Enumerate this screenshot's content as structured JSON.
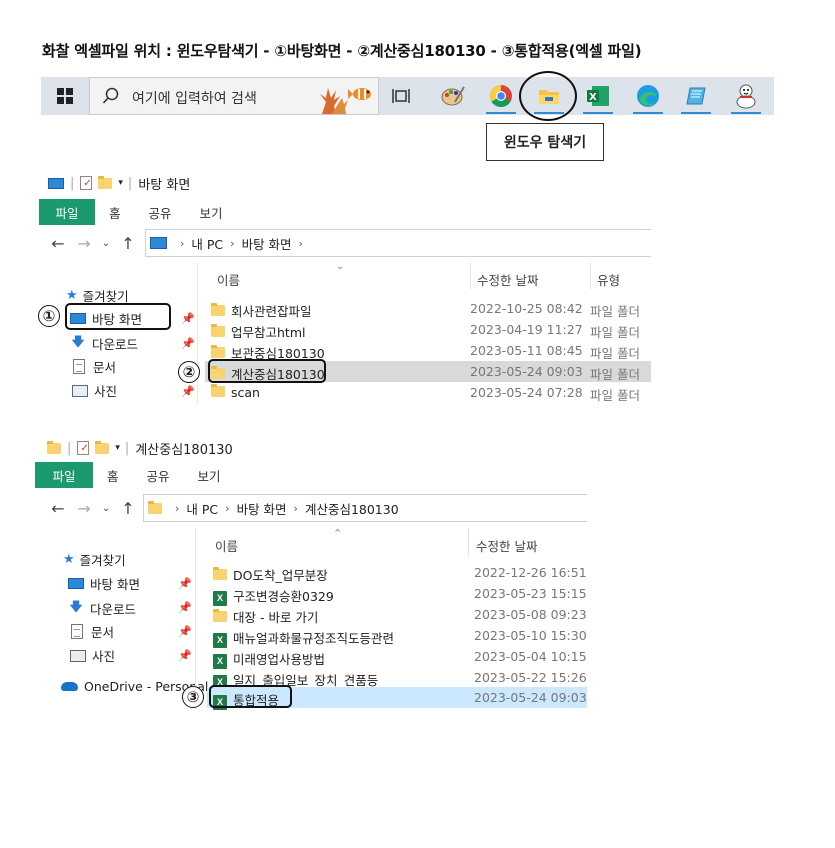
{
  "title": "화찰 엑셀파일 위치 : 윈도우탐색기 - ①바탕화면 - ②계산중심180130 - ③통합적용(엑셀 파일)",
  "taskbar": {
    "search_placeholder": "여기에 입력하여 검색",
    "icons": [
      "start-icon",
      "search-icon",
      "coral-fish-icon",
      "task-view-icon",
      "paint-icon",
      "chrome-icon",
      "file-explorer-icon",
      "excel-icon",
      "edge-icon",
      "notepad-icon",
      "snowman-icon"
    ],
    "callout": "윈도우 탐색기"
  },
  "window1": {
    "qat_title": "바탕 화면",
    "tabs": [
      "파일",
      "홈",
      "공유",
      "보기"
    ],
    "breadcrumb": [
      "내 PC",
      "바탕 화면"
    ],
    "columns": {
      "name": "이름",
      "date": "수정한 날짜",
      "type": "유형"
    },
    "nav": [
      {
        "label": "즐겨찾기"
      },
      {
        "label": "바탕 화면"
      },
      {
        "label": "다운로드"
      },
      {
        "label": "문서"
      },
      {
        "label": "사진"
      }
    ],
    "files": [
      {
        "name": "회사관련잡파일",
        "date": "2022-10-25 08:42",
        "type": "파일 폴더"
      },
      {
        "name": "업무참고html",
        "date": "2023-04-19 11:27",
        "type": "파일 폴더"
      },
      {
        "name": "보관중심180130",
        "date": "2023-05-11 08:45",
        "type": "파일 폴더"
      },
      {
        "name": "계산중심180130",
        "date": "2023-05-24 09:03",
        "type": "파일 폴더"
      },
      {
        "name": "scan",
        "date": "2023-05-24 07:28",
        "type": "파일 폴더"
      }
    ],
    "marker_1": "①",
    "marker_2": "②"
  },
  "window2": {
    "qat_title": "계산중심180130",
    "tabs": [
      "파일",
      "홈",
      "공유",
      "보기"
    ],
    "breadcrumb": [
      "내 PC",
      "바탕 화면",
      "계산중심180130"
    ],
    "columns": {
      "name": "이름",
      "date": "수정한 날짜"
    },
    "nav": [
      {
        "label": "즐겨찾기"
      },
      {
        "label": "바탕 화면"
      },
      {
        "label": "다운로드"
      },
      {
        "label": "문서"
      },
      {
        "label": "사진"
      },
      {
        "label": "OneDrive - Personal"
      }
    ],
    "files": [
      {
        "name": "DO도착_업무분장",
        "date": "2022-12-26 16:51",
        "icon": "folder"
      },
      {
        "name": "구조변경승환0329",
        "date": "2023-05-23 15:15",
        "icon": "excel"
      },
      {
        "name": "대장 - 바로 가기",
        "date": "2023-05-08 09:23",
        "icon": "folder"
      },
      {
        "name": "매뉴얼과화물규정조직도등관련",
        "date": "2023-05-10 15:30",
        "icon": "excel"
      },
      {
        "name": "미래영업사용방법",
        "date": "2023-05-04 10:15",
        "icon": "excel"
      },
      {
        "name": "일지_출입일보_장치_견품등",
        "date": "2023-05-22 15:26",
        "icon": "excel"
      },
      {
        "name": "통합적용",
        "date": "2023-05-24 09:03",
        "icon": "excel"
      }
    ],
    "marker_3": "③"
  }
}
